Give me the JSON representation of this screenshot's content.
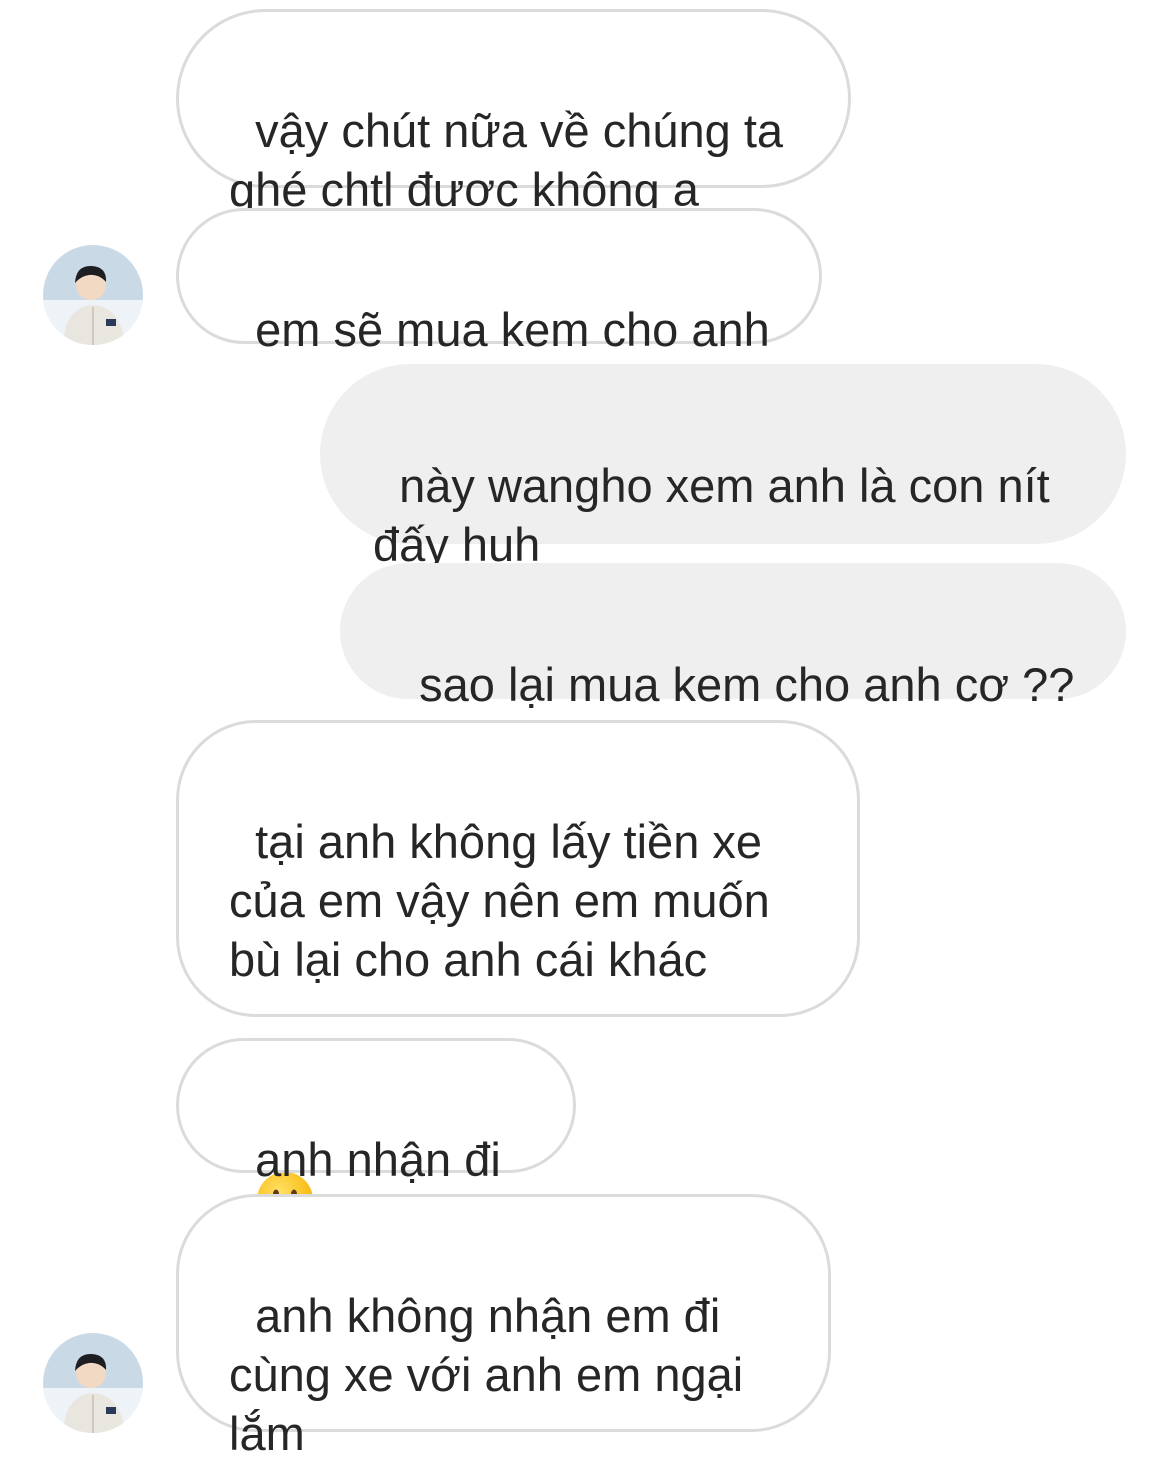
{
  "conversation": {
    "messages": [
      {
        "sender": "other",
        "text": "vậy chút nữa về chúng ta\nghé chtl được không ạ"
      },
      {
        "sender": "other",
        "text": "em sẽ mua kem cho anh"
      },
      {
        "sender": "me",
        "text": "này wangho xem anh là con nít\nđấy huh"
      },
      {
        "sender": "me",
        "text": "sao lại mua kem cho anh cơ ??"
      },
      {
        "sender": "other",
        "text": "tại anh không lấy tiền xe\ncủa em vậy nên em muốn\nbù lại cho anh cái khác",
        "emoji": "smiling-face-with-tear"
      },
      {
        "sender": "other",
        "text": "anh nhận đi ạ"
      },
      {
        "sender": "other",
        "text": "anh không nhận em đi\ncùng xe với anh em ngại\nlắm"
      }
    ]
  },
  "colors": {
    "incoming_border": "#dbdbdb",
    "outgoing_bg": "#efefef",
    "text": "#262626"
  }
}
